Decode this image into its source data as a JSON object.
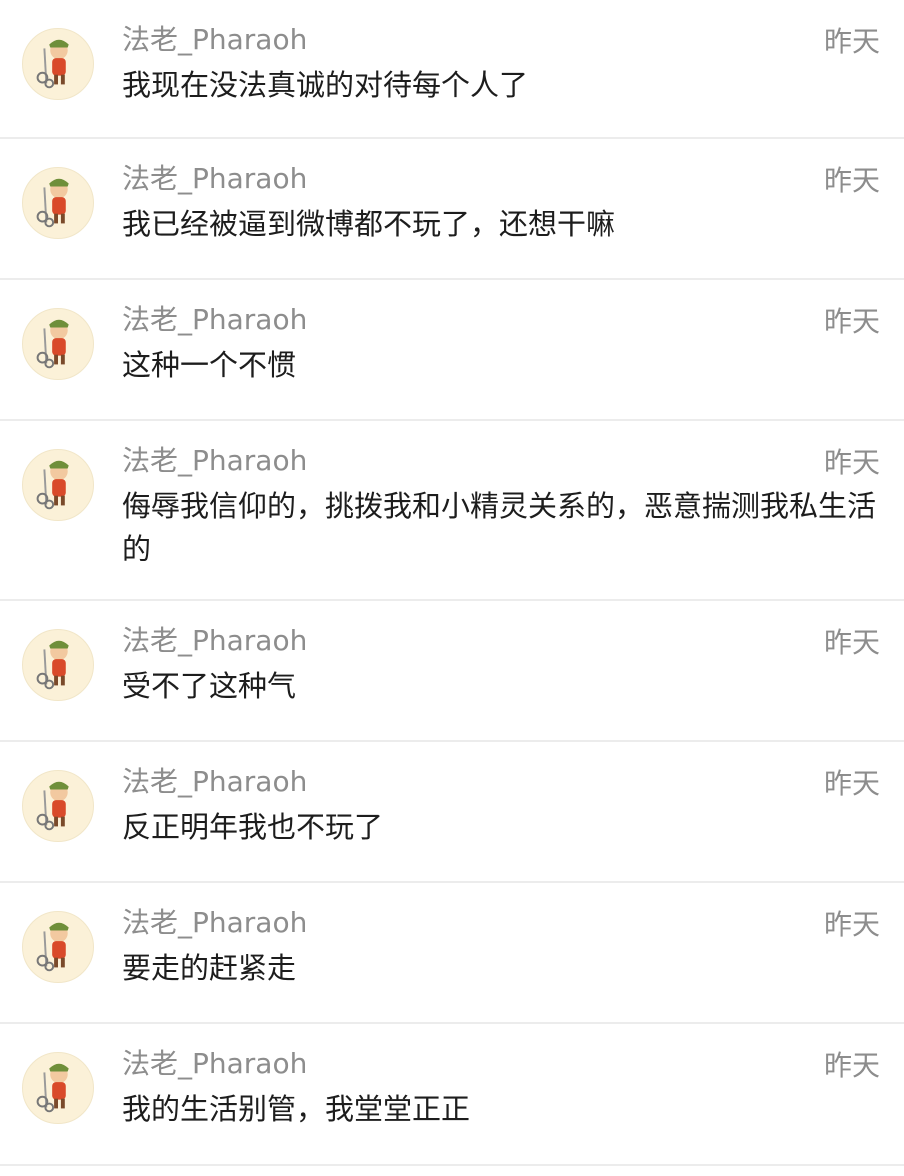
{
  "messages": [
    {
      "author": "法老_Pharaoh",
      "time": "昨天",
      "text": "我现在没法真诚的对待每个人了",
      "avatar_icon": "cartoon-character-avatar-icon"
    },
    {
      "author": "法老_Pharaoh",
      "time": "昨天",
      "text": "我已经被逼到微博都不玩了，还想干嘛",
      "avatar_icon": "cartoon-character-avatar-icon"
    },
    {
      "author": "法老_Pharaoh",
      "time": "昨天",
      "text": "这种一个不惯",
      "avatar_icon": "cartoon-character-avatar-icon"
    },
    {
      "author": "法老_Pharaoh",
      "time": "昨天",
      "text": "侮辱我信仰的，挑拨我和小精灵关系的，恶意揣测我私生活的",
      "avatar_icon": "cartoon-character-avatar-icon"
    },
    {
      "author": "法老_Pharaoh",
      "time": "昨天",
      "text": "受不了这种气",
      "avatar_icon": "cartoon-character-avatar-icon"
    },
    {
      "author": "法老_Pharaoh",
      "time": "昨天",
      "text": "反正明年我也不玩了",
      "avatar_icon": "cartoon-character-avatar-icon"
    },
    {
      "author": "法老_Pharaoh",
      "time": "昨天",
      "text": "要走的赶紧走",
      "avatar_icon": "cartoon-character-avatar-icon"
    },
    {
      "author": "法老_Pharaoh",
      "time": "昨天",
      "text": "我的生活别管，我堂堂正正",
      "avatar_icon": "cartoon-character-avatar-icon"
    }
  ],
  "colors": {
    "name_text": "#8d8d8d",
    "time_text": "#8d8d8d",
    "message_text": "#1d1d1d",
    "divider": "#ececec",
    "avatar_bg": "#fbf1d8"
  }
}
